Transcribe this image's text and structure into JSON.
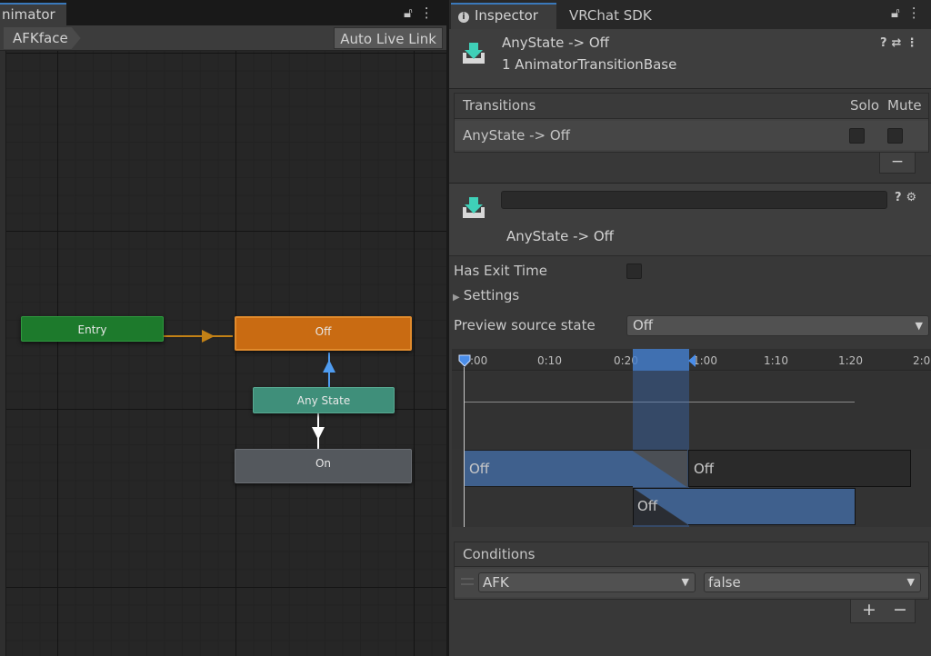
{
  "animator": {
    "tab_label": "nimator",
    "breadcrumb": "AFKface",
    "auto_live_link": "Auto Live Link",
    "lock_icon": "lock-icon",
    "menu_icon": "kebab-menu-icon",
    "nodes": {
      "entry": "Entry",
      "off": "Off",
      "any_state": "Any State",
      "on": "On"
    },
    "colors": {
      "entry": "#1d7a2c",
      "off": "#c96b12",
      "any_state": "#3f8f7a",
      "on": "#54585d",
      "edge_entry": "#c28116",
      "edge_selected": "#4f9cf0",
      "edge_normal": "#ffffff"
    }
  },
  "inspector": {
    "tabs": [
      {
        "label": "Inspector",
        "active": true
      },
      {
        "label": "VRChat SDK",
        "active": false
      }
    ],
    "header": {
      "title": "AnyState -> Off",
      "subtitle": "1 AnimatorTransitionBase"
    },
    "transitions": {
      "title": "Transitions",
      "col_solo": "Solo",
      "col_mute": "Mute",
      "rows": [
        {
          "name": "AnyState -> Off",
          "solo": false,
          "mute": false
        }
      ],
      "remove_label": "−"
    },
    "settings_header": {
      "name_value": "",
      "label": "AnyState -> Off"
    },
    "has_exit_time": {
      "label": "Has Exit Time",
      "checked": false
    },
    "settings_foldout": {
      "label": "Settings",
      "expanded": false
    },
    "preview_source": {
      "label": "Preview source state",
      "value": "Off"
    },
    "timeline": {
      "ticks": [
        ":00",
        "0:10",
        "0:20",
        "1:00",
        "1:10",
        "1:20",
        "2:0"
      ],
      "source_bar": "Off",
      "dest_bar_1": "Off",
      "dest_bar_2": "Off",
      "accent": "#3f608d"
    },
    "conditions": {
      "title": "Conditions",
      "rows": [
        {
          "parameter": "AFK",
          "value": "false"
        }
      ],
      "add_label": "+",
      "remove_label": "−"
    }
  }
}
